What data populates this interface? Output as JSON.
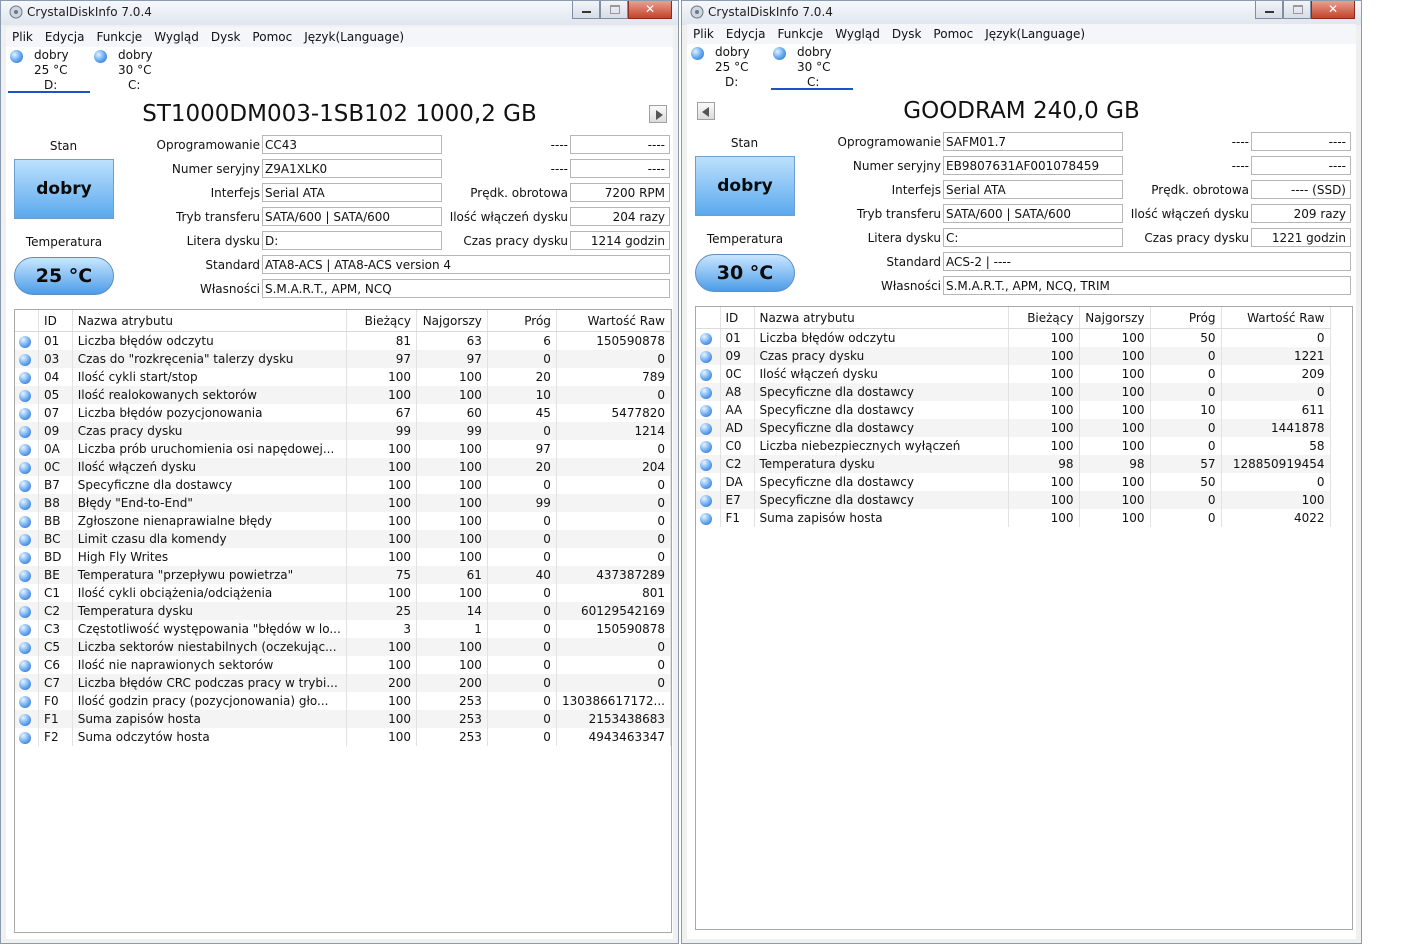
{
  "windows": [
    {
      "title": "CrystalDiskInfo 7.0.4",
      "menu": [
        "Plik",
        "Edycja",
        "Funkcje",
        "Wygląd",
        "Dysk",
        "Pomoc",
        "Język(Language)"
      ],
      "drives": [
        {
          "status": "dobry",
          "temp": "25 °C",
          "letter": "D:"
        },
        {
          "status": "dobry",
          "temp": "30 °C",
          "letter": "C:"
        }
      ],
      "active_drive": 0,
      "model": "ST1000DM003-1SB102 1000,2 GB",
      "labels": {
        "stan": "Stan",
        "temperatura": "Temperatura",
        "firmware": "Oprogramowanie",
        "serial": "Numer seryjny",
        "interface": "Interfejs",
        "transfer": "Tryb transferu",
        "letter": "Litera dysku",
        "standard": "Standard",
        "features": "Własności",
        "blank1": "----",
        "blank2": "----",
        "rpm": "Prędk. obrotowa",
        "power_on_count": "Ilość włączeń dysku",
        "power_on_hours": "Czas pracy dysku"
      },
      "health": "dobry",
      "temperature": "25 °C",
      "values": {
        "firmware": "CC43",
        "serial": "Z9A1XLK0",
        "interface": "Serial ATA",
        "transfer": "SATA/600 | SATA/600",
        "letter": "D:",
        "standard": "ATA8-ACS | ATA8-ACS version 4",
        "features": "S.M.A.R.T., APM, NCQ",
        "blank1": "----",
        "blank2": "----",
        "rpm": "7200 RPM",
        "power_on_count": "204 razy",
        "power_on_hours": "1214 godzin"
      },
      "columns": [
        "ID",
        "Nazwa atrybutu",
        "Bieżący",
        "Najgorszy",
        "Próg",
        "Wartość Raw"
      ],
      "rows": [
        [
          "01",
          "Liczba błędów odczytu",
          "81",
          "63",
          "6",
          "150590878"
        ],
        [
          "03",
          "Czas do \"rozkręcenia\" talerzy dysku",
          "97",
          "97",
          "0",
          "0"
        ],
        [
          "04",
          "Ilość cykli start/stop",
          "100",
          "100",
          "20",
          "789"
        ],
        [
          "05",
          "Ilość realokowanych sektorów",
          "100",
          "100",
          "10",
          "0"
        ],
        [
          "07",
          "Liczba błędów pozycjonowania",
          "67",
          "60",
          "45",
          "5477820"
        ],
        [
          "09",
          "Czas pracy dysku",
          "99",
          "99",
          "0",
          "1214"
        ],
        [
          "0A",
          "Liczba prób uruchomienia osi napędowej...",
          "100",
          "100",
          "97",
          "0"
        ],
        [
          "0C",
          "Ilość włączeń dysku",
          "100",
          "100",
          "20",
          "204"
        ],
        [
          "B7",
          "Specyficzne dla dostawcy",
          "100",
          "100",
          "0",
          "0"
        ],
        [
          "B8",
          "Błędy \"End-to-End\"",
          "100",
          "100",
          "99",
          "0"
        ],
        [
          "BB",
          "Zgłoszone nienaprawialne błędy",
          "100",
          "100",
          "0",
          "0"
        ],
        [
          "BC",
          "Limit czasu dla komendy",
          "100",
          "100",
          "0",
          "0"
        ],
        [
          "BD",
          "High Fly Writes",
          "100",
          "100",
          "0",
          "0"
        ],
        [
          "BE",
          "Temperatura \"przepływu powietrza\"",
          "75",
          "61",
          "40",
          "437387289"
        ],
        [
          "C1",
          "Ilość cykli obciążenia/odciążenia",
          "100",
          "100",
          "0",
          "801"
        ],
        [
          "C2",
          "Temperatura dysku",
          "25",
          "14",
          "0",
          "60129542169"
        ],
        [
          "C3",
          "Częstotliwość występowania \"błędów w lo...",
          "3",
          "1",
          "0",
          "150590878"
        ],
        [
          "C5",
          "Liczba sektorów niestabilnych (oczekując...",
          "100",
          "100",
          "0",
          "0"
        ],
        [
          "C6",
          "Ilość nie naprawionych sektorów",
          "100",
          "100",
          "0",
          "0"
        ],
        [
          "C7",
          "Liczba błędów CRC podczas pracy w trybi...",
          "200",
          "200",
          "0",
          "0"
        ],
        [
          "F0",
          "Ilość godzin pracy (pozycjonowania) gło...",
          "100",
          "253",
          "0",
          "130386617172..."
        ],
        [
          "F1",
          "Suma zapisów hosta",
          "100",
          "253",
          "0",
          "2153438683"
        ],
        [
          "F2",
          "Suma odczytów hosta",
          "100",
          "253",
          "0",
          "4943463347"
        ]
      ]
    },
    {
      "title": "CrystalDiskInfo 7.0.4",
      "menu": [
        "Plik",
        "Edycja",
        "Funkcje",
        "Wygląd",
        "Dysk",
        "Pomoc",
        "Język(Language)"
      ],
      "drives": [
        {
          "status": "dobry",
          "temp": "25 °C",
          "letter": "D:"
        },
        {
          "status": "dobry",
          "temp": "30 °C",
          "letter": "C:"
        }
      ],
      "active_drive": 1,
      "model": "GOODRAM 240,0 GB",
      "labels": {
        "stan": "Stan",
        "temperatura": "Temperatura",
        "firmware": "Oprogramowanie",
        "serial": "Numer seryjny",
        "interface": "Interfejs",
        "transfer": "Tryb transferu",
        "letter": "Litera dysku",
        "standard": "Standard",
        "features": "Własności",
        "blank1": "----",
        "blank2": "----",
        "rpm": "Prędk. obrotowa",
        "power_on_count": "Ilość włączeń dysku",
        "power_on_hours": "Czas pracy dysku"
      },
      "health": "dobry",
      "temperature": "30 °C",
      "values": {
        "firmware": "SAFM01.7",
        "serial": "EB9807631AF001078459",
        "interface": "Serial ATA",
        "transfer": "SATA/600 | SATA/600",
        "letter": "C:",
        "standard": "ACS-2 | ----",
        "features": "S.M.A.R.T., APM, NCQ, TRIM",
        "blank1": "----",
        "blank2": "----",
        "rpm": "---- (SSD)",
        "power_on_count": "209 razy",
        "power_on_hours": "1221 godzin"
      },
      "columns": [
        "ID",
        "Nazwa atrybutu",
        "Bieżący",
        "Najgorszy",
        "Próg",
        "Wartość Raw"
      ],
      "rows": [
        [
          "01",
          "Liczba błędów odczytu",
          "100",
          "100",
          "50",
          "0"
        ],
        [
          "09",
          "Czas pracy dysku",
          "100",
          "100",
          "0",
          "1221"
        ],
        [
          "0C",
          "Ilość włączeń dysku",
          "100",
          "100",
          "0",
          "209"
        ],
        [
          "A8",
          "Specyficzne dla dostawcy",
          "100",
          "100",
          "0",
          "0"
        ],
        [
          "AA",
          "Specyficzne dla dostawcy",
          "100",
          "100",
          "10",
          "611"
        ],
        [
          "AD",
          "Specyficzne dla dostawcy",
          "100",
          "100",
          "0",
          "1441878"
        ],
        [
          "C0",
          "Liczba niebezpiecznych wyłączeń",
          "100",
          "100",
          "0",
          "58"
        ],
        [
          "C2",
          "Temperatura dysku",
          "98",
          "98",
          "57",
          "128850919454"
        ],
        [
          "DA",
          "Specyficzne dla dostawcy",
          "100",
          "100",
          "50",
          "0"
        ],
        [
          "E7",
          "Specyficzne dla dostawcy",
          "100",
          "100",
          "0",
          "100"
        ],
        [
          "F1",
          "Suma zapisów hosta",
          "100",
          "100",
          "0",
          "4022"
        ]
      ]
    }
  ]
}
